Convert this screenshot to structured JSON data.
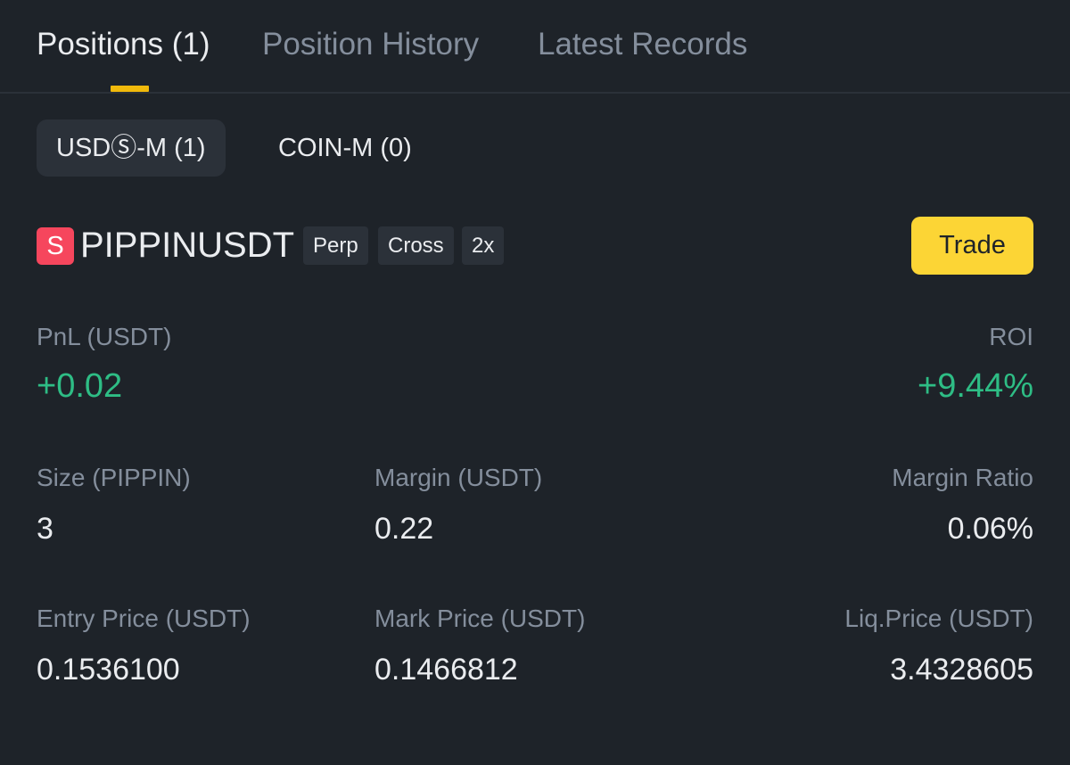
{
  "tabs": [
    {
      "label": "Positions (1)"
    },
    {
      "label": "Position History"
    },
    {
      "label": "Latest Records"
    }
  ],
  "subtabs": [
    {
      "label": "USDⓈ-M (1)"
    },
    {
      "label": "COIN-M (0)"
    }
  ],
  "position": {
    "badge": "S",
    "symbol": "PIPPINUSDT",
    "tags": [
      "Perp",
      "Cross",
      "2x"
    ],
    "trade_label": "Trade",
    "pnl_label": "PnL (USDT)",
    "pnl_value": "+0.02",
    "roi_label": "ROI",
    "roi_value": "+9.44%",
    "size_label": "Size (PIPPIN)",
    "size_value": "3",
    "margin_label": "Margin (USDT)",
    "margin_value": "0.22",
    "margin_ratio_label": "Margin Ratio",
    "margin_ratio_value": "0.06%",
    "entry_label": "Entry Price (USDT)",
    "entry_value": "0.1536100",
    "mark_label": "Mark Price (USDT)",
    "mark_value": "0.1466812",
    "liq_label": "Liq.Price (USDT)",
    "liq_value": "3.4328605"
  },
  "colors": {
    "background": "#1e2329",
    "accent": "#f0b90b",
    "trade_button": "#fcd535",
    "profit": "#2ebd85",
    "short_badge": "#f6465d"
  }
}
